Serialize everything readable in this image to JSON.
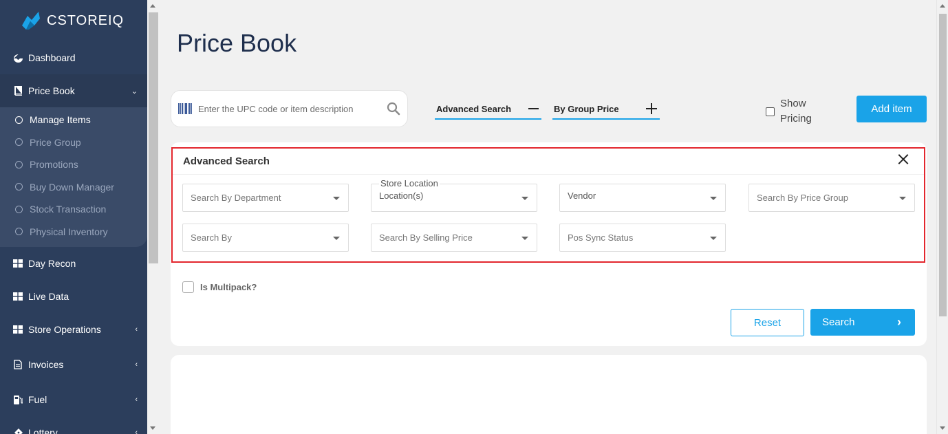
{
  "brand": {
    "name": "CSTOREIQ"
  },
  "sidebar": {
    "items": [
      {
        "label": "Dashboard",
        "icon": "palette-icon"
      },
      {
        "label": "Price Book",
        "icon": "book-icon",
        "chevron": "⌄"
      },
      {
        "label": "Day Recon",
        "icon": "grid-icon"
      },
      {
        "label": "Live Data",
        "icon": "grid-icon"
      },
      {
        "label": "Store Operations",
        "icon": "grid-icon",
        "chevron": "‹"
      },
      {
        "label": "Invoices",
        "icon": "document-icon",
        "chevron": "‹"
      },
      {
        "label": "Fuel",
        "icon": "fuel-icon",
        "chevron": "‹"
      },
      {
        "label": "Lottery",
        "icon": "ticket-icon",
        "chevron": "‹"
      }
    ],
    "price_book_sub": [
      {
        "label": "Manage Items"
      },
      {
        "label": "Price Group"
      },
      {
        "label": "Promotions"
      },
      {
        "label": "Buy Down Manager"
      },
      {
        "label": "Stock Transaction"
      },
      {
        "label": "Physical Inventory"
      }
    ]
  },
  "main": {
    "title": "Price Book",
    "search_placeholder": "Enter the UPC code or item description",
    "advanced_search_toggle": "Advanced Search",
    "group_price_toggle": "By Group Price",
    "show_pricing": "Show Pricing",
    "add_item": "Add item"
  },
  "advanced": {
    "title": "Advanced Search",
    "department": "Search By Department",
    "store_location_label": "Store Location",
    "store_location_value": "Location(s)",
    "vendor": "Vendor",
    "price_group": "Search By Price Group",
    "search_by": "Search By",
    "selling_price": "Search By Selling Price",
    "pos_sync": "Pos Sync Status",
    "multipack": "Is Multipack?",
    "reset": "Reset",
    "search": "Search"
  },
  "colors": {
    "accent": "#1aa3e8",
    "sidebar": "#2c3e5c",
    "highlight": "#e3262d"
  }
}
